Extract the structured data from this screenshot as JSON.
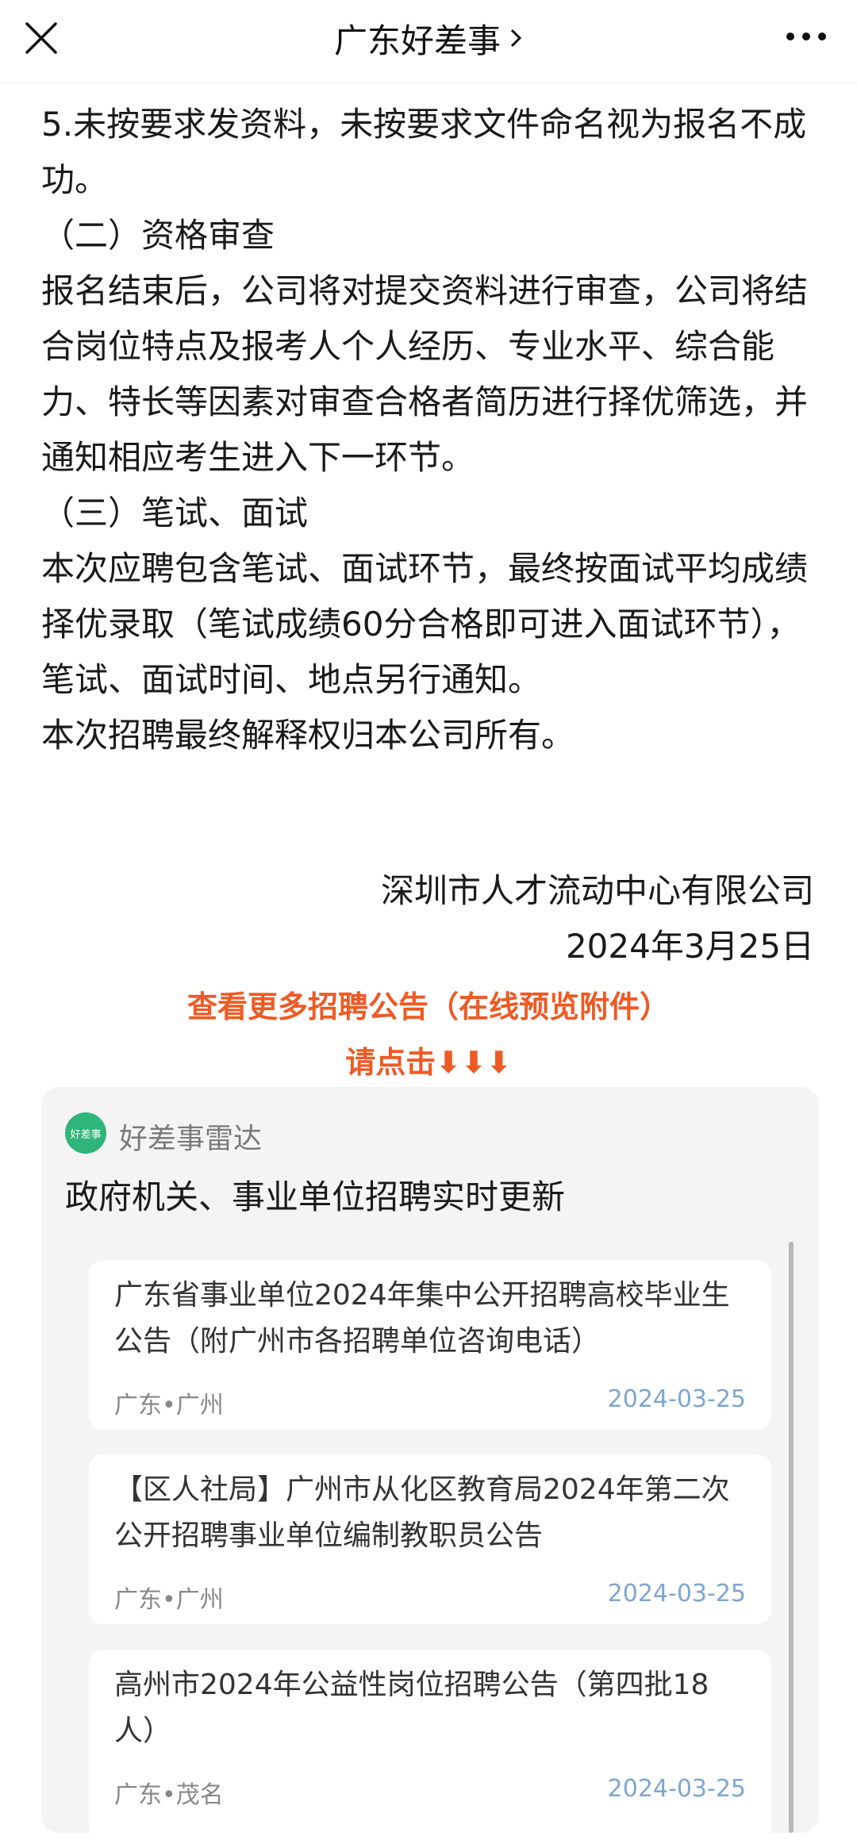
{
  "header": {
    "title": "广东好差事"
  },
  "article": {
    "paragraphs": [
      "5.未按要求发资料，未按要求文件命名视为报名不成功。",
      "（二）资格审查",
      "报名结束后，公司将对提交资料进行审查，公司将结合岗位特点及报考人个人经历、专业水平、综合能力、特长等因素对审查合格者简历进行择优筛选，并通知相应考生进入下一环节。",
      "（三）笔试、面试",
      "本次应聘包含笔试、面试环节，最终按面试平均成绩择优录取（笔试成绩60分合格即可进入面试环节），笔试、面试时间、地点另行通知。",
      "本次招聘最终解释权归本公司所有。"
    ],
    "signature_org": "深圳市人才流动中心有限公司",
    "signature_date": "2024年3月25日"
  },
  "promo": {
    "line1": "查看更多招聘公告（在线预览附件）",
    "line2": "请点击⬇⬇⬇"
  },
  "card": {
    "source_logo_text": "好差事",
    "source_name": "好差事雷达",
    "heading": "政府机关、事业单位招聘实时更新",
    "items": [
      {
        "title": "广东省事业单位2024年集中公开招聘高校毕业生公告（附广州市各招聘单位咨询电话）",
        "location": "广东•广州",
        "date": "2024-03-25"
      },
      {
        "title": "【区人社局】广州市从化区教育局2024年第二次公开招聘事业单位编制教职员公告",
        "location": "广东•广州",
        "date": "2024-03-25"
      },
      {
        "title": "高州市2024年公益性岗位招聘公告（第四批18人）",
        "location": "广东•茂名",
        "date": "2024-03-25"
      }
    ]
  },
  "colors": {
    "promo": "#ee5a24",
    "date": "#7ea6cf",
    "logo": "#2fb57a"
  }
}
